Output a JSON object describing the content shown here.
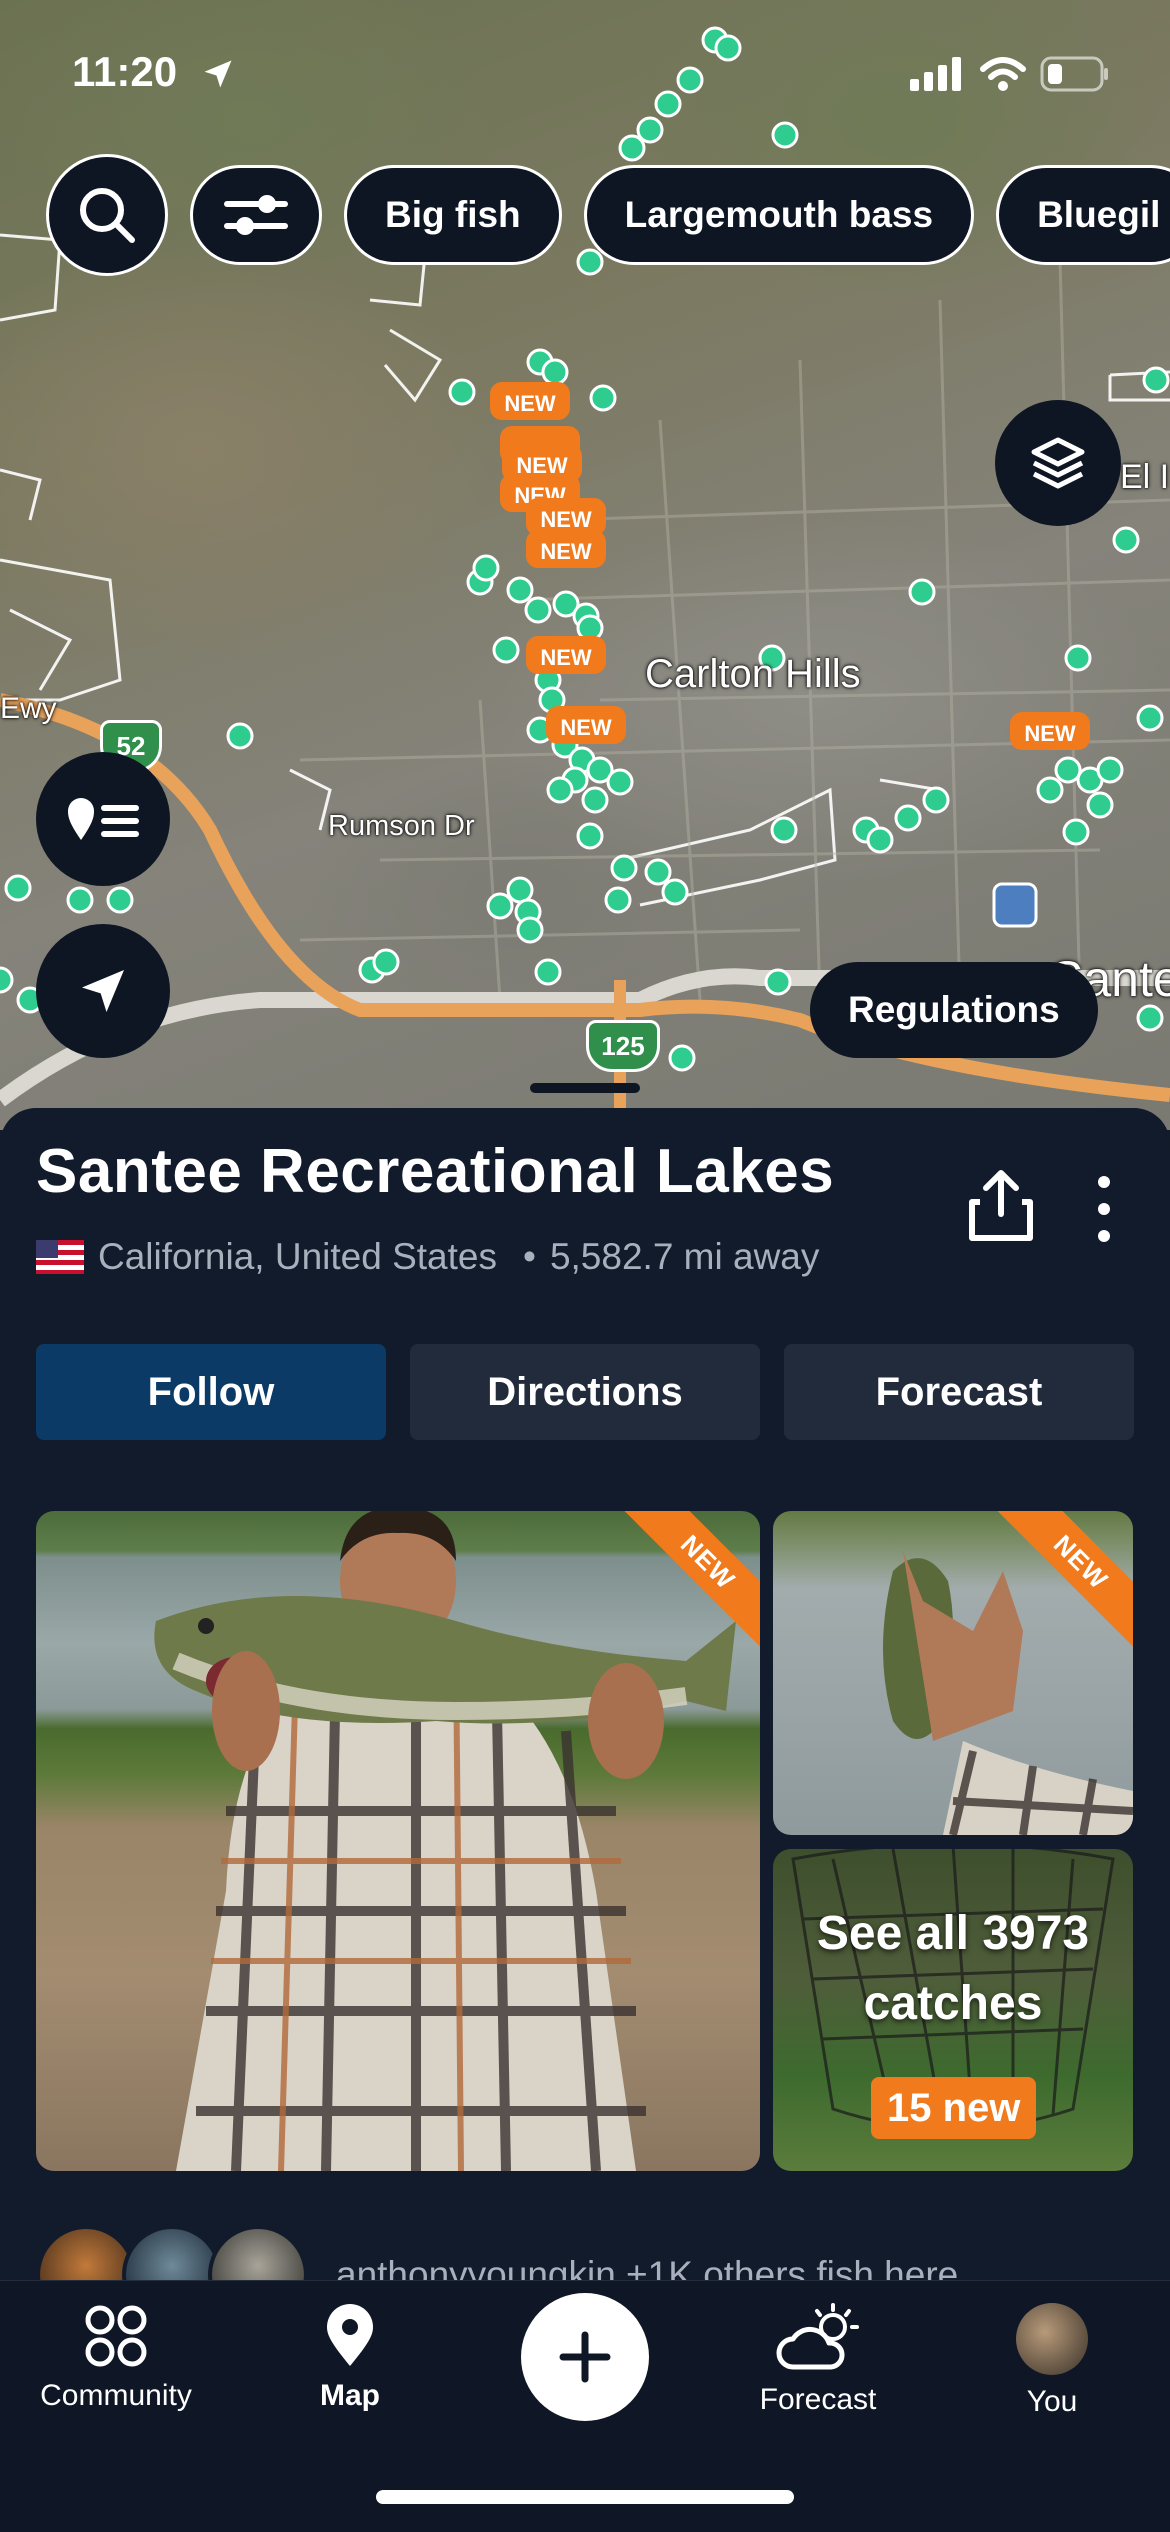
{
  "status_bar": {
    "time": "11:20"
  },
  "filter_chips": [
    "Big fish",
    "Largemouth bass",
    "Bluegil"
  ],
  "map": {
    "labels": {
      "carlton_hills": "Carlton Hills",
      "rumson_dr": "Rumson Dr",
      "ewy": "Ewy",
      "el": "El I",
      "sante": "Sante"
    },
    "shields": {
      "sr52": "52",
      "sr125": "125"
    },
    "new_marker": "NEW",
    "regulations_label": "Regulations",
    "pin_color": "#2ecc8f",
    "new_color": "#f07a1c"
  },
  "place": {
    "name": "Santee Recreational Lakes",
    "location": "California, United States",
    "distance": "5,582.7 mi away",
    "flag": "us-flag"
  },
  "actions": {
    "follow": "Follow",
    "directions": "Directions",
    "forecast": "Forecast"
  },
  "catches": {
    "ribbon": "NEW",
    "see_all": "See all 3973 catches",
    "new_count": "15 new"
  },
  "anglers": {
    "text": "anthonyyoungkin +1K others fish here"
  },
  "tabbar": {
    "community": "Community",
    "map": "Map",
    "forecast": "Forecast",
    "you": "You"
  },
  "colors": {
    "accent": "#0b3a66",
    "background": "#121b2b",
    "orange": "#f07a1c"
  }
}
